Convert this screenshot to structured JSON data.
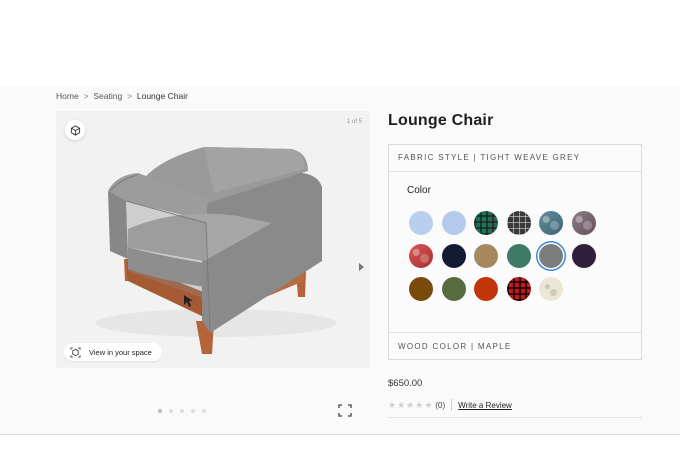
{
  "breadcrumb": {
    "items": [
      "Home",
      "Seating",
      "Lounge Chair"
    ],
    "separator": ">"
  },
  "viewer": {
    "counter": "1 of 5",
    "view_in_space_label": "View in your space",
    "icons": [
      "ar-cube-icon",
      "chevron-right-icon",
      "fullscreen-icon",
      "view-in-space-icon"
    ],
    "dot_count": 5,
    "active_dot": 0
  },
  "product": {
    "title": "Lounge Chair",
    "price": "$650.00",
    "rating_count": "(0)",
    "review_link": "Write a Review",
    "stars": 0
  },
  "options": {
    "fabric_header": "FABRIC STYLE | TIGHT WEAVE GREY",
    "color_label": "Color",
    "wood_header": "WOOD COLOR | MAPLE",
    "swatches": [
      {
        "name": "light-blue-1",
        "color": "#b9cfee",
        "pattern": "solid"
      },
      {
        "name": "light-blue-2",
        "color": "#b4caeb",
        "pattern": "solid"
      },
      {
        "name": "green-plaid",
        "color": "#1f6e58",
        "pattern": "plaid"
      },
      {
        "name": "grey-plaid",
        "color": "#3a3a3a",
        "pattern": "plaid-grey"
      },
      {
        "name": "blue-marble",
        "color": "#4a7a8c",
        "pattern": "marble"
      },
      {
        "name": "mauve-marble",
        "color": "#7a6670",
        "pattern": "marble"
      },
      {
        "name": "red-marble",
        "color": "#d33a3a",
        "pattern": "marble"
      },
      {
        "name": "navy",
        "color": "#131a33",
        "pattern": "solid"
      },
      {
        "name": "tan",
        "color": "#a68a5e",
        "pattern": "solid"
      },
      {
        "name": "teal",
        "color": "#3f7a66",
        "pattern": "solid"
      },
      {
        "name": "grey-selected",
        "color": "#7c7c7c",
        "pattern": "solid",
        "selected": true
      },
      {
        "name": "aubergine",
        "color": "#2e1f3c",
        "pattern": "solid"
      },
      {
        "name": "brown",
        "color": "#7a4a0c",
        "pattern": "solid"
      },
      {
        "name": "olive",
        "color": "#566c3e",
        "pattern": "solid"
      },
      {
        "name": "rust",
        "color": "#c0360a",
        "pattern": "solid"
      },
      {
        "name": "red-plaid",
        "color": "#c21a1a",
        "pattern": "plaid-red"
      },
      {
        "name": "cream-marble",
        "color": "#ece6d4",
        "pattern": "marble-light"
      }
    ]
  },
  "colors": {
    "accent": "#3a8dd8",
    "chair_fabric": "#8e8e8e",
    "chair_wood": "#b5643a"
  }
}
